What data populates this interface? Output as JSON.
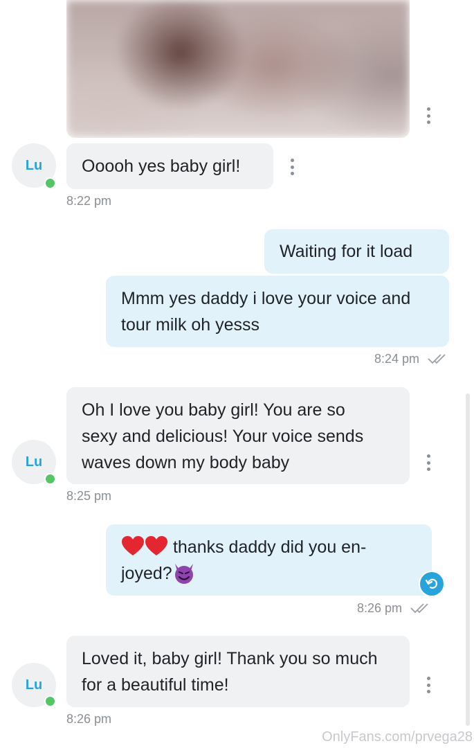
{
  "messages": [
    {
      "text": "Ooooh yes baby girl!",
      "time": "8:22 pm",
      "sender": "Lu"
    },
    {
      "text": "Waiting for it load"
    },
    {
      "text": "Mmm yes daddy i love your voice and tour milk oh yesss",
      "time": "8:24 pm"
    },
    {
      "text": "Oh I love you baby girl! You are so sexy and delicious! Your voice sends waves down my body baby",
      "time": "8:25 pm",
      "sender": "Lu"
    },
    {
      "text_line1": "thanks daddy did you en-",
      "text_line2": "joyed?",
      "time": "8:26 pm"
    },
    {
      "text": "Loved it, baby girl! Thank you so much for a beautiful time!",
      "time": "8:26 pm",
      "sender": "Lu"
    }
  ],
  "avatar_initials": "Lu",
  "watermark": "OnlyFans.com/prvega28",
  "icons": {
    "more": "kebab-vertical-icon",
    "read_receipt": "double-check-icon",
    "undo": "undo-icon",
    "heart": "red-heart-emoji",
    "devil": "smiling-devil-emoji"
  },
  "colors": {
    "incoming_bubble": "#f0f1f3",
    "outgoing_bubble": "#e1f2fb",
    "accent": "#2aa3dc",
    "online": "#55c565"
  }
}
